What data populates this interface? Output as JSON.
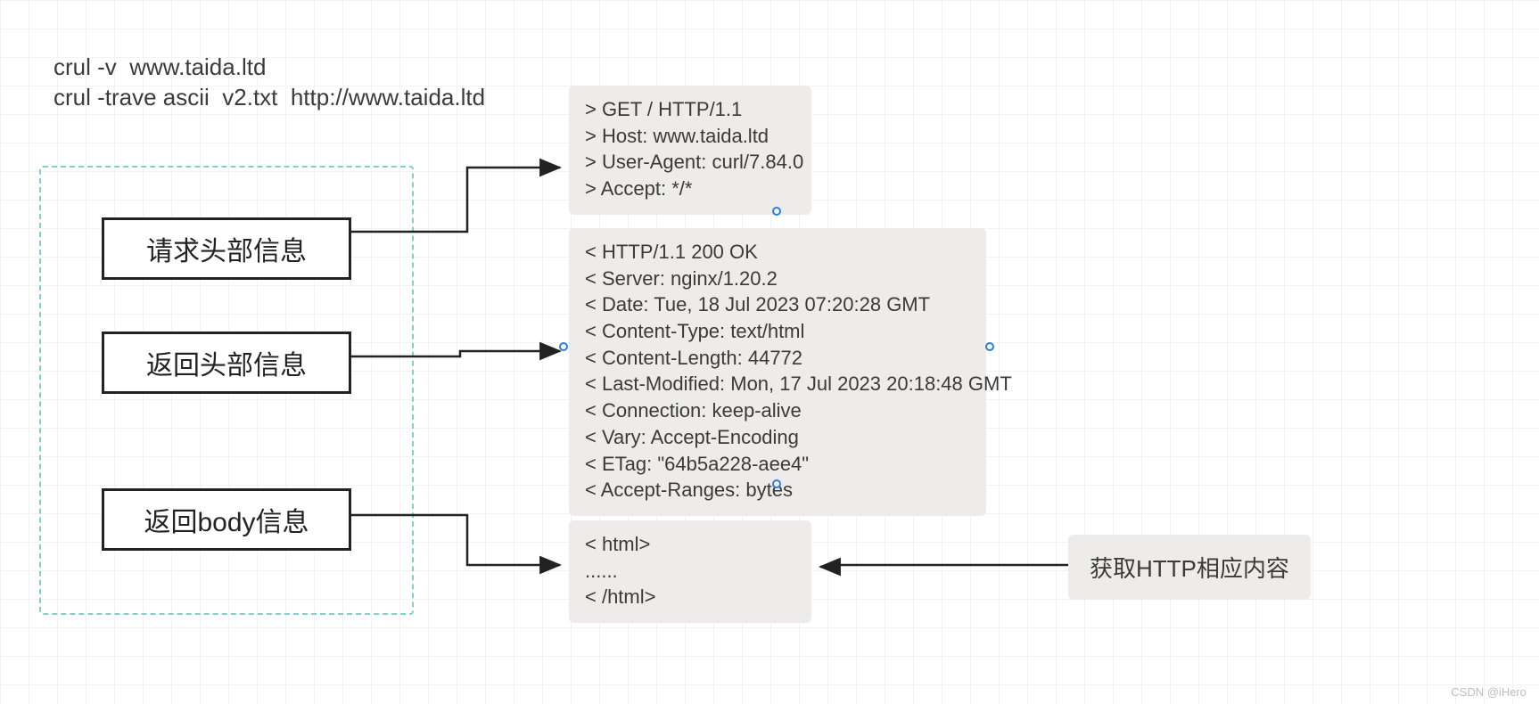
{
  "commands": {
    "line1": "crul -v  www.taida.ltd",
    "line2": "crul -trave ascii  v2.txt  http://www.taida.ltd"
  },
  "labels": {
    "request_header": "请求头部信息",
    "response_header": "返回头部信息",
    "response_body": "返回body信息",
    "fetch_http_content": "获取HTTP相应内容"
  },
  "panels": {
    "request": "> GET / HTTP/1.1\n> Host: www.taida.ltd\n> User-Agent: curl/7.84.0\n> Accept: */*",
    "response_header": "< HTTP/1.1 200 OK\n< Server: nginx/1.20.2\n< Date: Tue, 18 Jul 2023 07:20:28 GMT\n< Content-Type: text/html\n< Content-Length: 44772\n< Last-Modified: Mon, 17 Jul 2023 20:18:48 GMT\n< Connection: keep-alive\n< Vary: Accept-Encoding\n< ETag: \"64b5a228-aee4\"\n< Accept-Ranges: bytes",
    "response_body": "< html>\n......\n< /html>"
  },
  "watermark": "CSDN @iHero"
}
